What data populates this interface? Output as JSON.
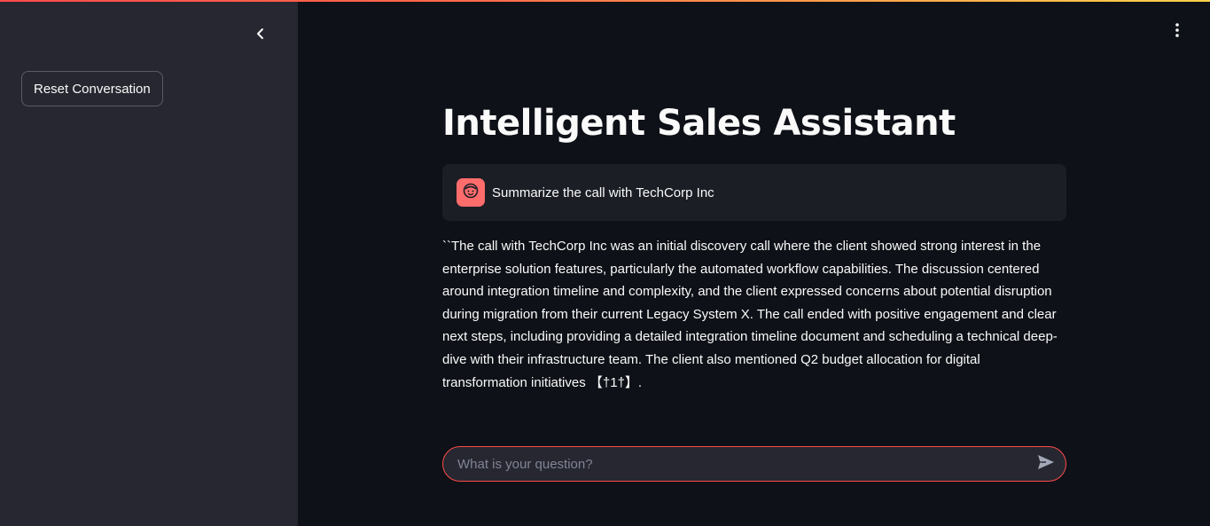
{
  "sidebar": {
    "reset_label": "Reset Conversation"
  },
  "main": {
    "title": "Intelligent Sales Assistant",
    "user_message": "Summarize the call with TechCorp Inc",
    "assistant_message": "``The call with TechCorp Inc was an initial discovery call where the client showed strong interest in the enterprise solution features, particularly the automated workflow capabilities. The discussion centered around integration timeline and complexity, and the client expressed concerns about potential disruption during migration from their current Legacy System X. The call ended with positive engagement and clear next steps, including providing a detailed integration timeline document and scheduling a technical deep-dive with their infrastructure team. The client also mentioned Q2 budget allocation for digital transformation initiatives 【†1†】."
  },
  "chat_input": {
    "placeholder": "What is your question?",
    "value": ""
  },
  "icons": {
    "collapse": "chevron-left-icon",
    "menu": "kebab-menu-icon",
    "avatar": "user-face-icon",
    "send": "send-icon"
  },
  "colors": {
    "accent": "#ff4b4b",
    "avatar_bg": "#ff6c6c",
    "sidebar_bg": "#262730",
    "main_bg": "#0e1117"
  }
}
